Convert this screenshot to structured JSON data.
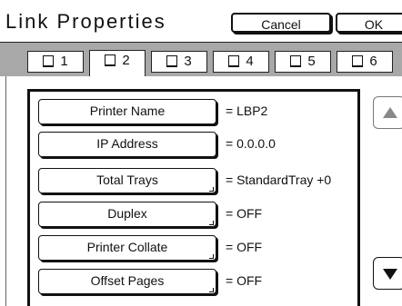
{
  "header": {
    "title": "Link Properties",
    "cancel_label": "Cancel",
    "ok_label": "OK"
  },
  "tabs": [
    {
      "label": "1",
      "active": false
    },
    {
      "label": "2",
      "active": true
    },
    {
      "label": "3",
      "active": false
    },
    {
      "label": "4",
      "active": false
    },
    {
      "label": "5",
      "active": false
    },
    {
      "label": "6",
      "active": false
    }
  ],
  "properties": [
    {
      "label": "Printer Name",
      "value": "= LBP2",
      "has_submenu": false
    },
    {
      "label": "IP Address",
      "value": "= 0.0.0.0",
      "has_submenu": false
    },
    {
      "label": "Total Trays",
      "value": "= StandardTray +0",
      "has_submenu": true
    },
    {
      "label": "Duplex",
      "value": "= OFF",
      "has_submenu": true
    },
    {
      "label": "Printer Collate",
      "value": "= OFF",
      "has_submenu": true
    },
    {
      "label": "Offset Pages",
      "value": "= OFF",
      "has_submenu": true
    }
  ],
  "scroll": {
    "up_icon": "triangle-up-icon",
    "up_enabled": false,
    "down_icon": "triangle-down-icon",
    "down_enabled": true
  }
}
